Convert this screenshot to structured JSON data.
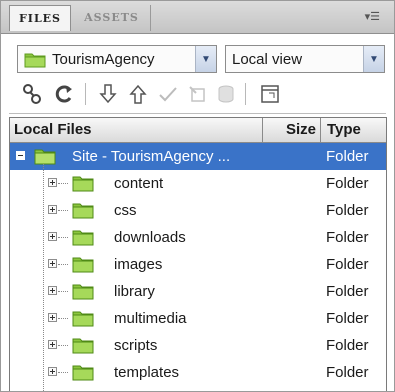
{
  "tabs": [
    {
      "label": "FILES",
      "active": true
    },
    {
      "label": "ASSETS",
      "active": false
    }
  ],
  "panel_menu_icon": "panel-menu-icon",
  "site_select": {
    "value": "TourismAgency",
    "icon": "site-folder-icon"
  },
  "view_select": {
    "value": "Local view"
  },
  "toolbar": [
    {
      "icon": "connect-icon",
      "enabled": true
    },
    {
      "icon": "refresh-icon",
      "enabled": true
    },
    {
      "icon": "get-files-icon",
      "enabled": true
    },
    {
      "icon": "put-files-icon",
      "enabled": true
    },
    {
      "icon": "check-out-icon",
      "enabled": false
    },
    {
      "icon": "check-in-icon",
      "enabled": false
    },
    {
      "icon": "synchronize-icon",
      "enabled": false
    },
    {
      "icon": "expand-panel-icon",
      "enabled": true
    }
  ],
  "columns": {
    "name": "Local Files",
    "size": "Size",
    "type": "Type"
  },
  "root": {
    "name": "Site - TourismAgency ...",
    "type": "Folder",
    "selected": true
  },
  "folders": [
    {
      "name": "content",
      "type": "Folder"
    },
    {
      "name": "css",
      "type": "Folder"
    },
    {
      "name": "downloads",
      "type": "Folder"
    },
    {
      "name": "images",
      "type": "Folder"
    },
    {
      "name": "library",
      "type": "Folder"
    },
    {
      "name": "multimedia",
      "type": "Folder"
    },
    {
      "name": "scripts",
      "type": "Folder"
    },
    {
      "name": "templates",
      "type": "Folder"
    }
  ],
  "colors": {
    "selection": "#3a73c8",
    "folder": "#8cc63f",
    "folder_dark": "#5e9b1e"
  }
}
